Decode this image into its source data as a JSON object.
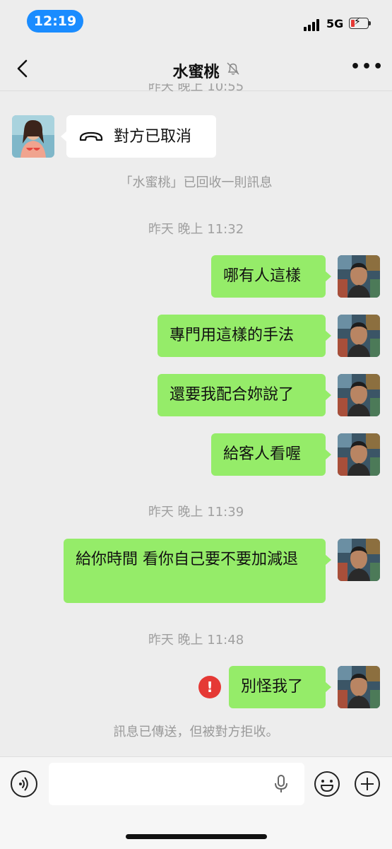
{
  "status": {
    "time": "12:19",
    "network": "5G"
  },
  "header": {
    "title": "水蜜桃",
    "back_label": "<",
    "more_label": "•••"
  },
  "chat": {
    "partial_timestamp": "昨天 晚上 10:55",
    "call_cancelled": "對方已取消",
    "recalled_notice": "「水蜜桃」已回收一則訊息",
    "timestamp_1": "昨天 晚上 11:32",
    "msg_1": "哪有人這樣",
    "msg_2": "專門用這樣的手法",
    "msg_3": "還要我配合妳說了",
    "msg_4": "給客人看喔",
    "timestamp_2": "昨天 晚上 11:39",
    "msg_5": "給你時間 看你自己要不要加減退",
    "timestamp_3": "昨天 晚上 11:48",
    "msg_6": "別怪我了",
    "failed_icon": "!",
    "rejected_notice": "訊息已傳送，但被對方拒收。"
  },
  "input": {
    "placeholder": ""
  },
  "colors": {
    "sent_bubble": "#95ec69",
    "received_bubble": "#ffffff",
    "background": "#ededed",
    "error": "#e53935",
    "status_pill": "#1a8cff"
  },
  "icons": {
    "back": "chevron-left-icon",
    "mute": "bell-slash-icon",
    "more": "more-dots-icon",
    "call": "phone-hangup-icon",
    "voice": "voice-icon",
    "mic": "microphone-icon",
    "emoji": "emoji-icon",
    "plus": "plus-icon",
    "error": "error-icon"
  }
}
